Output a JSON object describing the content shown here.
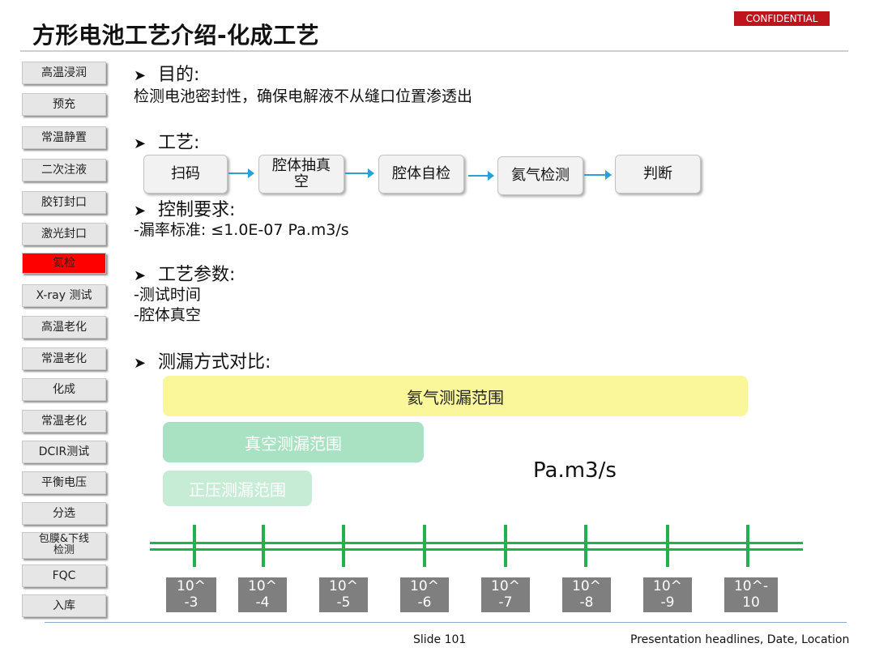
{
  "title": "方形电池工艺介绍-化成工艺",
  "badge": "CONFIDENTIAL",
  "sidebar": {
    "items": [
      {
        "label": "高温浸润"
      },
      {
        "label": "预充"
      },
      {
        "label": "常温静置"
      },
      {
        "label": "二次注液"
      },
      {
        "label": "胶钉封口"
      },
      {
        "label": "激光封口"
      },
      {
        "label": "氦检"
      },
      {
        "label": "X-ray 测试"
      },
      {
        "label": "高温老化"
      },
      {
        "label": "常温老化"
      },
      {
        "label": "化成"
      },
      {
        "label": "常温老化"
      },
      {
        "label": "DCIR测试"
      },
      {
        "label": "平衡电压"
      },
      {
        "label": "分选"
      },
      {
        "label": "包膜&下线",
        "label2": "检测"
      },
      {
        "label": "FQC"
      },
      {
        "label": "入库"
      }
    ],
    "active_color": "#ff0000"
  },
  "purpose": {
    "heading": "目的:",
    "text": "检测电池密封性，确保电解液不从缝口位置渗透出"
  },
  "process": {
    "heading": "工艺:",
    "steps": [
      {
        "label": "扫码"
      },
      {
        "label": "腔体抽真",
        "label2": "空"
      },
      {
        "label": "腔体自检"
      },
      {
        "label": "氦气检测"
      },
      {
        "label": "判断"
      }
    ],
    "arrow_color": "#2aa0d6"
  },
  "control": {
    "heading": "控制要求:",
    "text": "-漏率标准:   ≤1.0E-07 Pa.m3/s"
  },
  "params": {
    "heading": "工艺参数:",
    "lines": [
      "-测试时间",
      "-腔体真空"
    ]
  },
  "comparison": {
    "heading": "测漏方式对比:",
    "ranges": [
      {
        "label": "氦气测漏范围",
        "color": "#f9f79a"
      },
      {
        "label": "真空测漏范围",
        "color": "#a9e2c2"
      },
      {
        "label": "正压测漏范围",
        "color": "#c6ecd6"
      }
    ],
    "unit": "Pa.m3/s",
    "axis_color": "#22b14c",
    "exponents": [
      {
        "top": "10^",
        "bottom": "-3"
      },
      {
        "top": "10^",
        "bottom": "-4"
      },
      {
        "top": "10^",
        "bottom": "-5"
      },
      {
        "top": "10^",
        "bottom": "-6"
      },
      {
        "top": "10^",
        "bottom": "-7"
      },
      {
        "top": "10^",
        "bottom": "-8"
      },
      {
        "top": "10^",
        "bottom": "-9"
      },
      {
        "top": "10^-",
        "bottom": "10"
      }
    ]
  },
  "footer": {
    "slide": "Slide 101",
    "headline": "Presentation headlines, Date, Location"
  }
}
